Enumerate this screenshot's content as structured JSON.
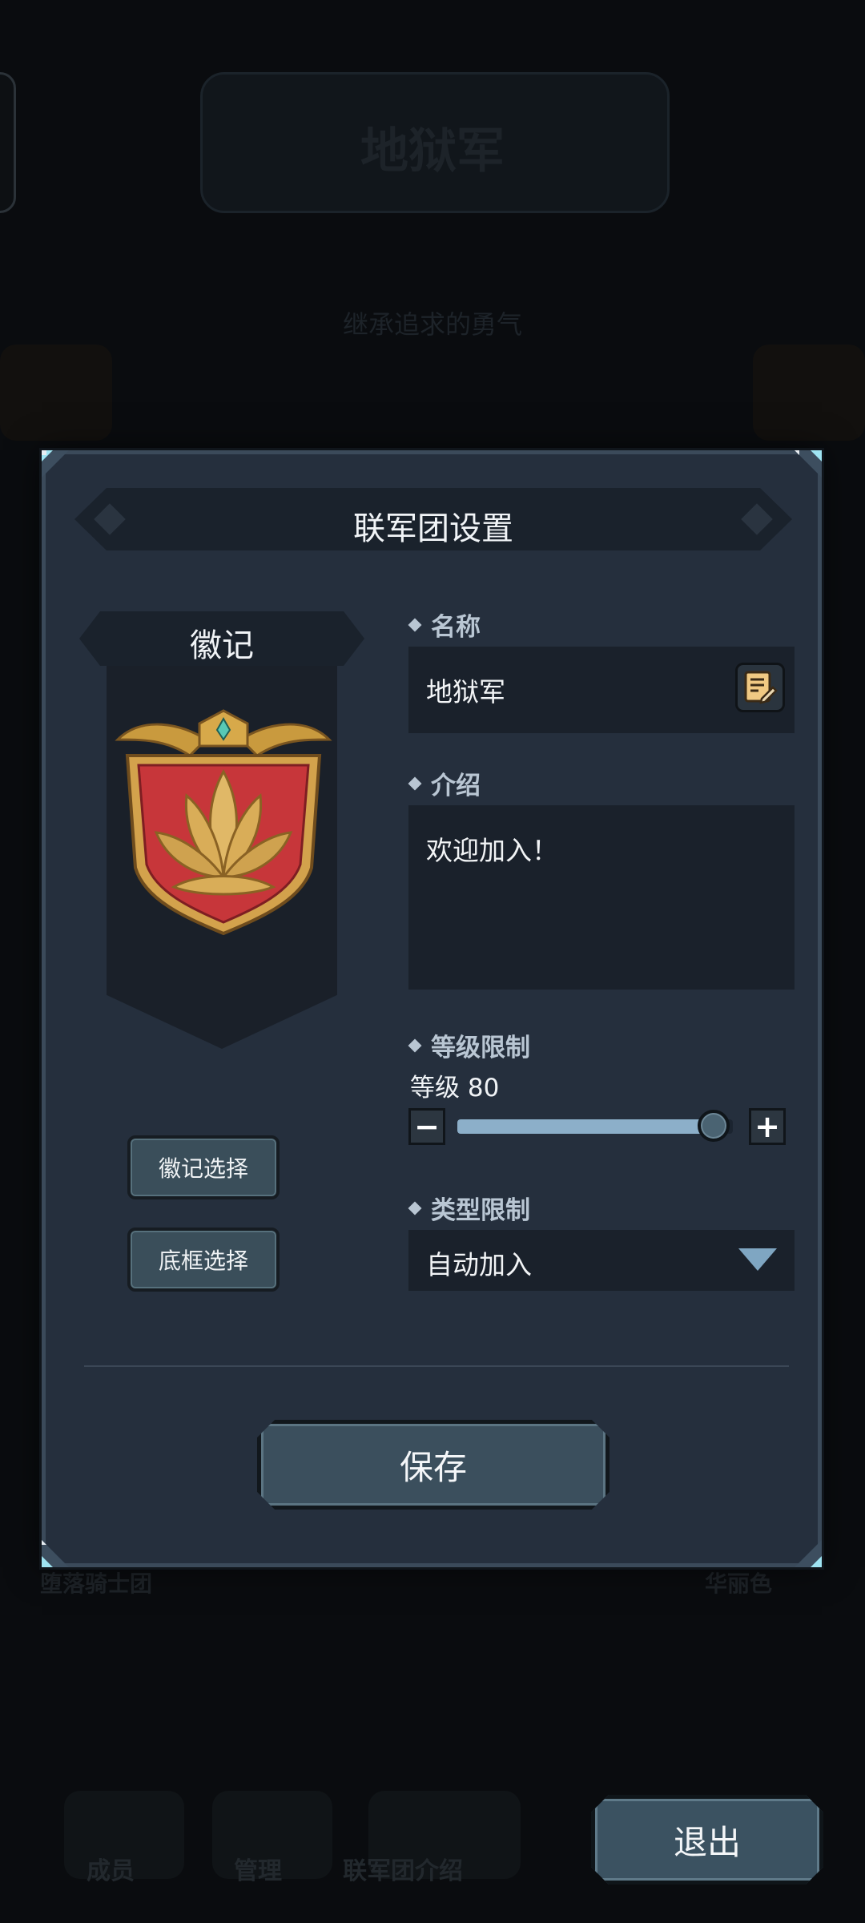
{
  "background": {
    "title": "地狱军",
    "subtitle": "继承追求的勇气",
    "labels": [
      "堕落骑士团",
      "华丽色"
    ],
    "nav": [
      "成员",
      "管理",
      "联军团介绍"
    ]
  },
  "dialog": {
    "title": "联军团设置",
    "emblem_label": "徽记",
    "emblem_select_button": "徽记选择",
    "frame_select_button": "底框选择",
    "name_label": "名称",
    "name_value": "地狱军",
    "intro_label": "介绍",
    "intro_value": "欢迎加入！",
    "level_label": "等级限制",
    "level_value_text": "等级 80",
    "level_slider_fraction": 0.93,
    "type_label": "类型限制",
    "type_value": "自动加入",
    "save_button": "保存"
  },
  "exit_button": "退出",
  "colors": {
    "panel": "#252f3d",
    "field": "#1a212b",
    "slider_fill": "#8cafc9",
    "accent_gem": "#9fe4f2"
  },
  "icons": [
    "edit-note-icon",
    "minus-icon",
    "plus-icon",
    "dropdown-arrow-icon",
    "lotus-emblem-icon"
  ]
}
